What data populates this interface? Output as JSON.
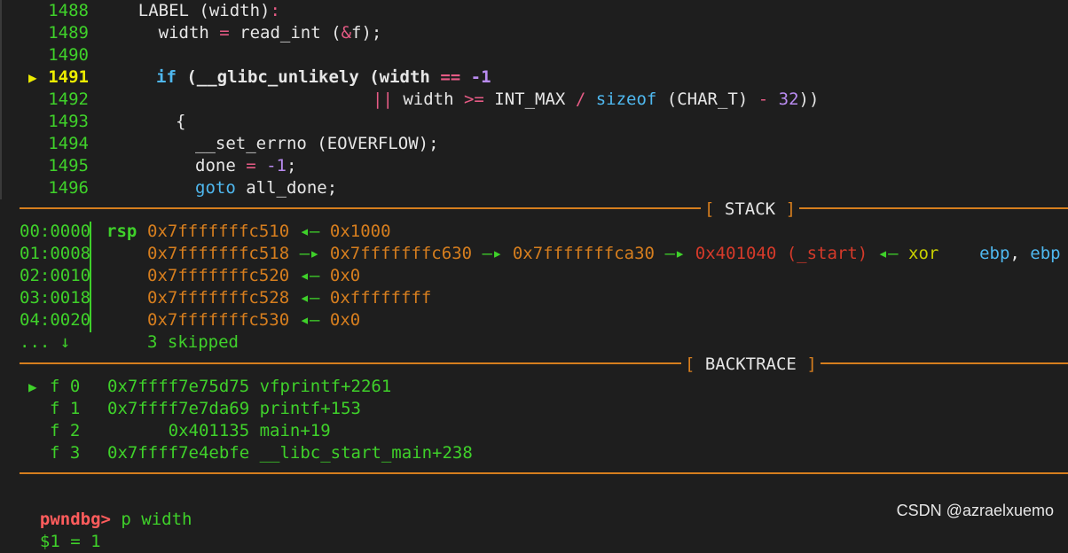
{
  "source": {
    "lines": [
      {
        "no": "1488",
        "current": false
      },
      {
        "no": "1489",
        "current": false
      },
      {
        "no": "1490",
        "current": false
      },
      {
        "no": "1491",
        "current": true
      },
      {
        "no": "1492",
        "current": false
      },
      {
        "no": "1493",
        "current": false
      },
      {
        "no": "1494",
        "current": false
      },
      {
        "no": "1495",
        "current": false
      },
      {
        "no": "1496",
        "current": false
      }
    ],
    "current_marker": "▶",
    "code": {
      "l1488_a": "    LABEL (width)",
      "l1488_b": ":",
      "l1489_a": "      width ",
      "l1489_op": "=",
      "l1489_b": " read_int (",
      "l1489_amp": "&",
      "l1489_c": "f);",
      "l1491_kw": "if",
      "l1491_a": " (__glibc_unlikely (width ",
      "l1491_op": "==",
      "l1491_sp": " ",
      "l1491_num": "-1",
      "l1492_op1": "||",
      "l1492_a": " width ",
      "l1492_op2": ">=",
      "l1492_b": " INT_MAX ",
      "l1492_op3": "/",
      "l1492_sp": " ",
      "l1492_kw": "sizeof",
      "l1492_c": " (CHAR_T) ",
      "l1492_op4": "-",
      "l1492_sp2": " ",
      "l1492_num": "32",
      "l1492_d": "))",
      "l1493": "{",
      "l1494": "__set_errno (EOVERFLOW);",
      "l1495_a": "done ",
      "l1495_op": "=",
      "l1495_sp": " ",
      "l1495_num": "-1",
      "l1495_b": ";",
      "l1496_kw": "goto",
      "l1496_a": " all_done;"
    }
  },
  "stack": {
    "header": "STACK",
    "bracket_open": "[",
    "bracket_close": "]",
    "rows": [
      {
        "offset": "00:0000",
        "reg": "rsp",
        "addr": "0x7fffffffc510",
        "arrow": " ◂— ",
        "val": "0x1000"
      },
      {
        "offset": "01:0008",
        "reg": "",
        "addr": "0x7fffffffc518",
        "arrow": " —▸ ",
        "val": "0x7fffffffc630"
      },
      {
        "offset": "02:0010",
        "reg": "",
        "addr": "0x7fffffffc520",
        "arrow": " ◂— ",
        "val": "0x0"
      },
      {
        "offset": "03:0018",
        "reg": "",
        "addr": "0x7fffffffc528",
        "arrow": " ◂— ",
        "val": "0xffffffff"
      },
      {
        "offset": "04:0020",
        "reg": "",
        "addr": "0x7fffffffc530",
        "arrow": " ◂— ",
        "val": "0x0"
      }
    ],
    "row1_chain": {
      "a2": " —▸ ",
      "v2": "0x7fffffffca30",
      "a3": " —▸ ",
      "v3": "0x401040 (_start)",
      "a4": " ◂— ",
      "ins": "xor",
      "ops_a": "    ebp",
      "comma": ", ",
      "ops_b": "ebp"
    },
    "skipped_prefix": "... ↓",
    "skipped_text": "3 skipped"
  },
  "backtrace": {
    "header": "BACKTRACE",
    "bracket_open": "[",
    "bracket_close": "]",
    "marker": "▶",
    "frames": [
      {
        "frame": "f 0",
        "addr": "0x7ffff7e75d75",
        "sym": " vfprintf+2261"
      },
      {
        "frame": "f 1",
        "addr": "0x7ffff7e7da69",
        "sym": " printf+153"
      },
      {
        "frame": "f 2",
        "addr": "      0x401135",
        "sym": " main+19"
      },
      {
        "frame": "f 3",
        "addr": "0x7ffff7e4ebfe",
        "sym": " __libc_start_main+238"
      }
    ]
  },
  "console": {
    "prompt": "pwndbg>",
    "command": " p width",
    "output": "$1 = 1"
  },
  "watermark": "CSDN @azraelxuemo",
  "colors": {
    "background": "#1e1e1e",
    "separator": "#d67e1e",
    "green": "#3fd12a",
    "keyword": "#4fb8ef",
    "operator": "#e65b85",
    "number": "#b98bf0",
    "current_line": "#ecec00",
    "address": "#d67e1e",
    "red": "#d53a2a",
    "prompt": "#ff5c5c"
  }
}
